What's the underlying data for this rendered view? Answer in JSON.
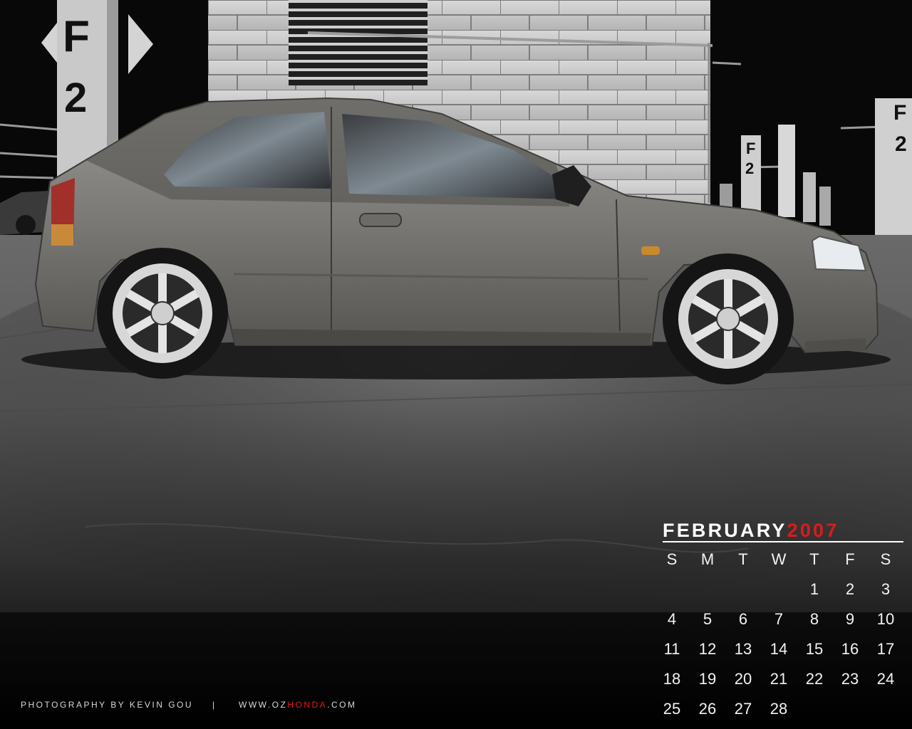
{
  "calendar": {
    "month": "FEBRUARY",
    "year": "2007",
    "weekdays": [
      "S",
      "M",
      "T",
      "W",
      "T",
      "F",
      "S"
    ],
    "weeks": [
      [
        "",
        "",
        "",
        "",
        "1",
        "2",
        "3"
      ],
      [
        "4",
        "5",
        "6",
        "7",
        "8",
        "9",
        "10"
      ],
      [
        "11",
        "12",
        "13",
        "14",
        "15",
        "16",
        "17"
      ],
      [
        "18",
        "19",
        "20",
        "21",
        "22",
        "23",
        "24"
      ],
      [
        "25",
        "26",
        "27",
        "28",
        "",
        "",
        ""
      ]
    ]
  },
  "credits": {
    "photographer": "PHOTOGRAPHY BY KEVIN GOU",
    "separator": "|",
    "url_prefix": "WWW.OZ",
    "url_brand": "HONDA",
    "url_suffix": ".COM"
  },
  "signage": {
    "level_letter": "F",
    "level_number": "2"
  },
  "colors": {
    "accent": "#d91c1c",
    "text": "#ffffff"
  }
}
